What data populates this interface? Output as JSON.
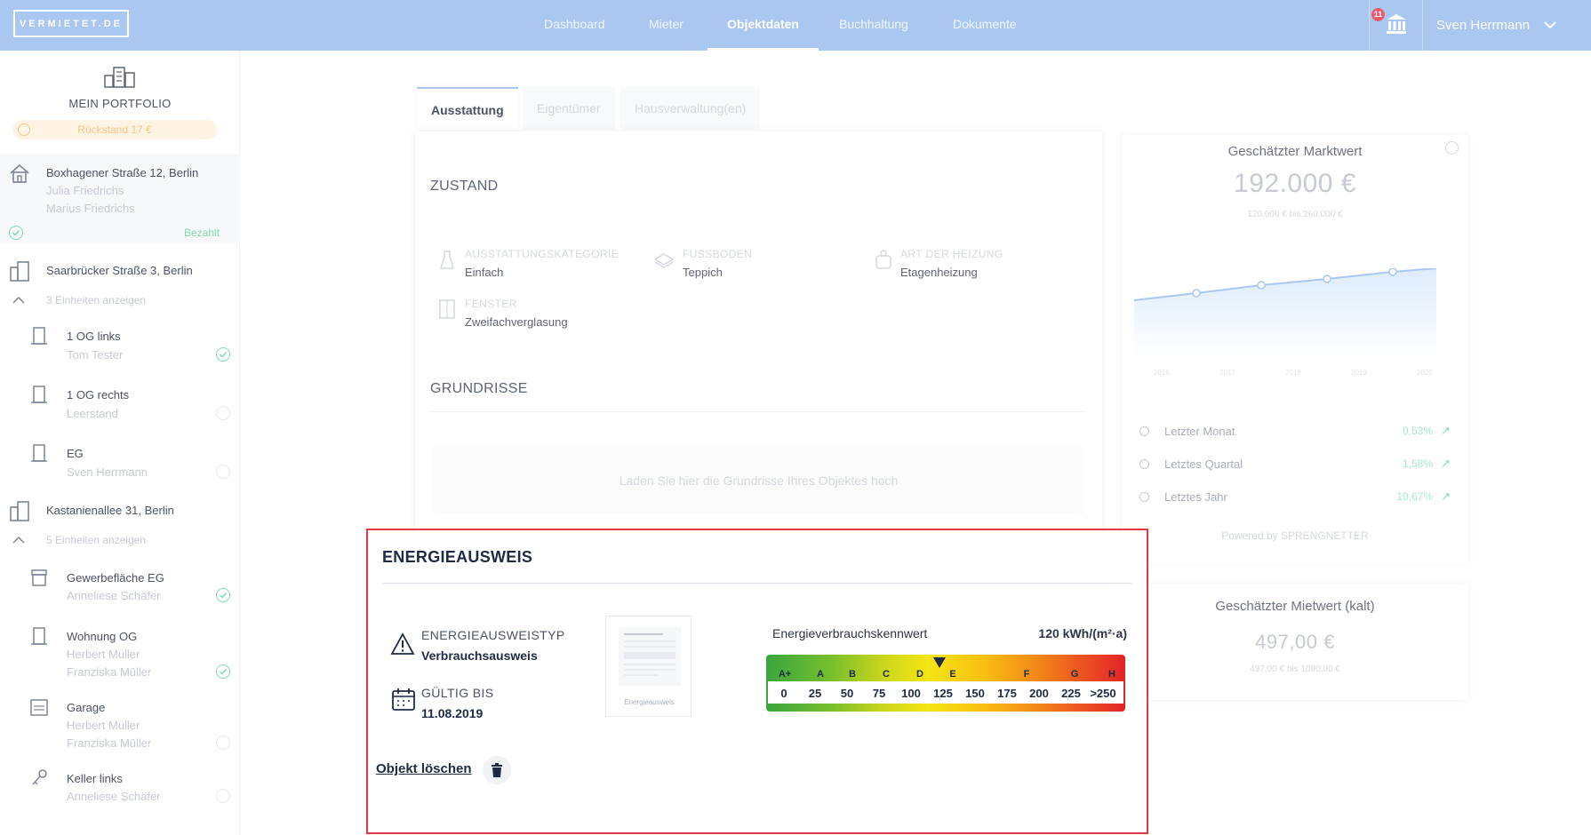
{
  "navbar": {
    "logo": "VERMIETET.DE",
    "tabs": [
      "Dashboard",
      "Mieter",
      "Objektdaten",
      "Buchhaltung",
      "Dokumente"
    ],
    "active_tab": "Objektdaten",
    "notification_count": "11",
    "user_name": "Sven Herrmann"
  },
  "sidebar": {
    "portfolio_title": "MEIN PORTFOLIO",
    "warning_pill": "Rückstand 17 €",
    "properties": [
      {
        "title": "Boxhagener Straße 12, Berlin",
        "tenants": [
          "Julia Friedrichs",
          "Marius Friedrichs"
        ],
        "status": "Bezahlt"
      },
      {
        "title": "Saarbrücker Straße 3, Berlin",
        "toggle": "3 Einheiten anzeigen",
        "units": [
          {
            "title": "1 OG links",
            "sub": [
              "Tom Tester"
            ]
          },
          {
            "title": "1 OG rechts",
            "sub": [
              "Leerstand"
            ]
          },
          {
            "title": "EG",
            "sub": [
              "Sven Herrmann"
            ]
          }
        ]
      },
      {
        "title": "Kastanienallee 31, Berlin",
        "toggle": "5 Einheiten anzeigen",
        "units": [
          {
            "title": "Gewerbefläche EG",
            "sub": [
              "Anneliese Schäfer"
            ]
          },
          {
            "title": "Wohnung OG",
            "sub": [
              "Herbert Müller",
              "Franziska Müller"
            ]
          },
          {
            "title": "Garage",
            "sub": [
              "Herbert Müller",
              "Franziska Müller"
            ]
          },
          {
            "title": "Keller links",
            "sub": [
              "Anneliese Schäfer"
            ]
          }
        ]
      }
    ]
  },
  "subtabs": [
    "Ausstattung",
    "Eigentümer",
    "Hausverwaltung(en)"
  ],
  "zustand": {
    "heading": "ZUSTAND",
    "features": [
      {
        "label": "AUSSTATTUNGSKATEGORIE",
        "value": "Einfach"
      },
      {
        "label": "FUSSBODEN",
        "value": "Teppich"
      },
      {
        "label": "ART DER HEIZUNG",
        "value": "Etagenheizung"
      },
      {
        "label": "FENSTER",
        "value": "Zweifachverglasung"
      }
    ]
  },
  "grundrisse": {
    "heading": "GRUNDRISSE",
    "upload_hint": "Laden Sie hier die Grundrisse Ihres Objektes hoch"
  },
  "marktwert": {
    "title": "Geschätzter Marktwert",
    "value": "192.000 €",
    "range": "120.000 € bis 260.000 €",
    "chart_years": [
      "2016",
      "2017",
      "2018",
      "2019",
      "2020"
    ],
    "trends": [
      {
        "label": "Letzter Monat",
        "value": "0,53%"
      },
      {
        "label": "Letztes Quartal",
        "value": "1,58%"
      },
      {
        "label": "Letztes Jahr",
        "value": "10,67%"
      }
    ],
    "powered_by": "Powered by SPRENGNETTER"
  },
  "mietwert": {
    "title": "Geschätzter Mietwert (kalt)",
    "value": "497,00 €",
    "range": "497,00 € bis 1090,00 €"
  },
  "energie": {
    "title": "ENERGIEAUSWEIS",
    "type_label": "ENERGIEAUSWEISTYP",
    "type_value": "Verbrauchsausweis",
    "valid_label": "GÜLTIG BIS",
    "valid_value": "11.08.2019",
    "thumb_caption": "Energieausweis",
    "kennwert_label": "Energieverbrauchskennwert",
    "kennwert_value": "120 kWh/(m²·a)",
    "classes": [
      "A+",
      "A",
      "B",
      "C",
      "D",
      "E",
      "F",
      "G",
      "H"
    ],
    "scale_numbers": [
      "0",
      "25",
      "50",
      "75",
      "100",
      "125",
      "150",
      "175",
      "200",
      "225",
      ">250"
    ],
    "delete_label": "Objekt löschen"
  }
}
